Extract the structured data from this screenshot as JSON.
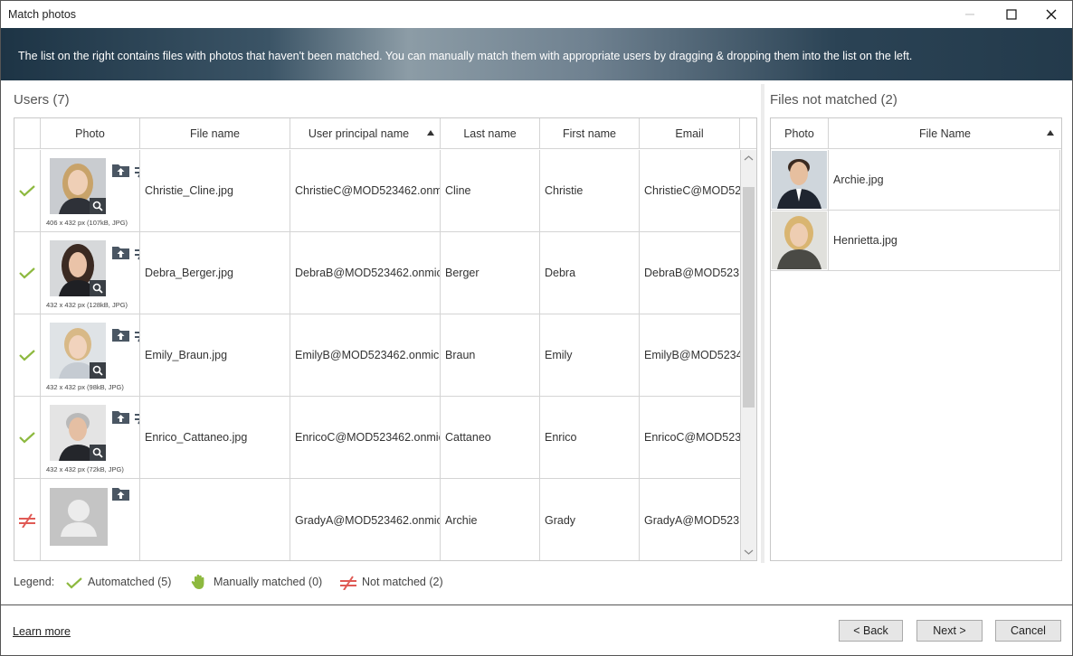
{
  "window": {
    "title": "Match photos"
  },
  "banner": {
    "text": "The list on the right contains files with photos that haven't been matched. You can manually match them with appropriate users by dragging & dropping them into the list on the left."
  },
  "users": {
    "title": "Users (7)",
    "columns": {
      "photo": "Photo",
      "file": "File name",
      "upn": "User principal name",
      "last": "Last name",
      "first": "First name",
      "email": "Email"
    },
    "rows": [
      {
        "status": "auto",
        "caption": "406 x 432 px (107kB, JPG)",
        "file": "Christie_Cline.jpg",
        "upn": "ChristieC@MOD523462.onmi",
        "last": "Cline",
        "first": "Christie",
        "email": "ChristieC@MOD52"
      },
      {
        "status": "auto",
        "caption": "432 x 432 px (128kB, JPG)",
        "file": "Debra_Berger.jpg",
        "upn": "DebraB@MOD523462.onmicı",
        "last": "Berger",
        "first": "Debra",
        "email": "DebraB@MOD523"
      },
      {
        "status": "auto",
        "caption": "432 x 432 px (98kB, JPG)",
        "file": "Emily_Braun.jpg",
        "upn": "EmilyB@MOD523462.onmicr",
        "last": "Braun",
        "first": "Emily",
        "email": "EmilyB@MOD5234"
      },
      {
        "status": "auto",
        "caption": "432 x 432 px (72kB, JPG)",
        "file": "Enrico_Cattaneo.jpg",
        "upn": "EnricoC@MOD523462.onmic",
        "last": "Cattaneo",
        "first": "Enrico",
        "email": "EnricoC@MOD523"
      },
      {
        "status": "none",
        "caption": "",
        "file": "",
        "upn": "GradyA@MOD523462.onmicı",
        "last": "Archie",
        "first": "Grady",
        "email": "GradyA@MOD523"
      }
    ]
  },
  "files": {
    "title": "Files not matched (2)",
    "columns": {
      "photo": "Photo",
      "name": "File Name"
    },
    "rows": [
      {
        "name": "Archie.jpg"
      },
      {
        "name": "Henrietta.jpg"
      }
    ]
  },
  "legend": {
    "label": "Legend:",
    "auto": "Automatched (5)",
    "manual": "Manually matched (0)",
    "none": "Not matched (2)"
  },
  "footer": {
    "learn_more": "Learn more",
    "back": "< Back",
    "next": "Next >",
    "cancel": "Cancel"
  },
  "colors": {
    "match_green": "#8db93f",
    "unmatched_red": "#e05a55",
    "icon_gray": "#4a5663",
    "banner_dark": "#1d3445"
  }
}
